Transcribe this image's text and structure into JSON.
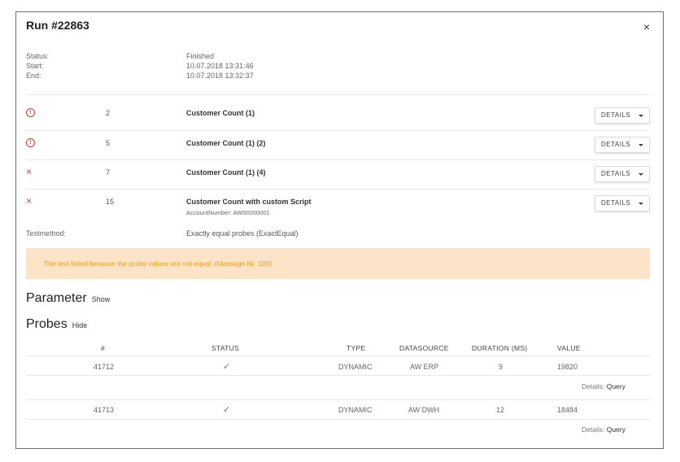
{
  "dialog": {
    "title": "Run #22863",
    "close_glyph": "×"
  },
  "meta": {
    "status_label": "Status:",
    "start_label": "Start:",
    "end_label": "End:",
    "status_value": "Finished",
    "start_value": "10.07.2018 13:31:46",
    "end_value": "10.07.2018 13:32:37"
  },
  "results": [
    {
      "icon": "warning-circle-icon",
      "glyph": "!",
      "num": "2",
      "name": "Customer Count (1)",
      "button": "DETAILS"
    },
    {
      "icon": "warning-circle-icon",
      "glyph": "!",
      "num": "5",
      "name": "Customer Count (1) (2)",
      "button": "DETAILS"
    },
    {
      "icon": "fail-x-icon",
      "glyph": "×",
      "num": "7",
      "name": "Customer Count (1) (4)",
      "button": "DETAILS"
    },
    {
      "icon": "fail-x-icon",
      "glyph": "×",
      "num": "15",
      "name": "Customer Count with custom Script",
      "sub": "AccountNumber: AW00000001",
      "button": "DETAILS"
    }
  ],
  "testmethod": {
    "label": "Testmethod:",
    "value": "Exactly equal probes (ExactEqual)"
  },
  "alert": {
    "text": "The test failed because the probe values are not equal.  (Message Nr. 103)",
    "color": "#f39c12",
    "background": "#fde4c9"
  },
  "parameter": {
    "title": "Parameter",
    "link": "Show"
  },
  "probes": {
    "title": "Probes",
    "link": "Hide",
    "columns": [
      "#",
      "STATUS",
      "TYPE",
      "DATASOURCE",
      "DURATION (MS)",
      "VALUE"
    ],
    "rows": [
      {
        "id": "41712",
        "status": "✓",
        "type": "DYNAMIC",
        "datasource": "AW ERP",
        "duration": "9",
        "value": "19820",
        "details_label": "Details:",
        "details_link": "Query"
      },
      {
        "id": "41713",
        "status": "✓",
        "type": "DYNAMIC",
        "datasource": "AW DWH",
        "duration": "12",
        "value": "18484",
        "details_label": "Details:",
        "details_link": "Query"
      }
    ]
  },
  "colors": {
    "error": "#e53935",
    "text": "#333333",
    "muted": "#666666"
  }
}
